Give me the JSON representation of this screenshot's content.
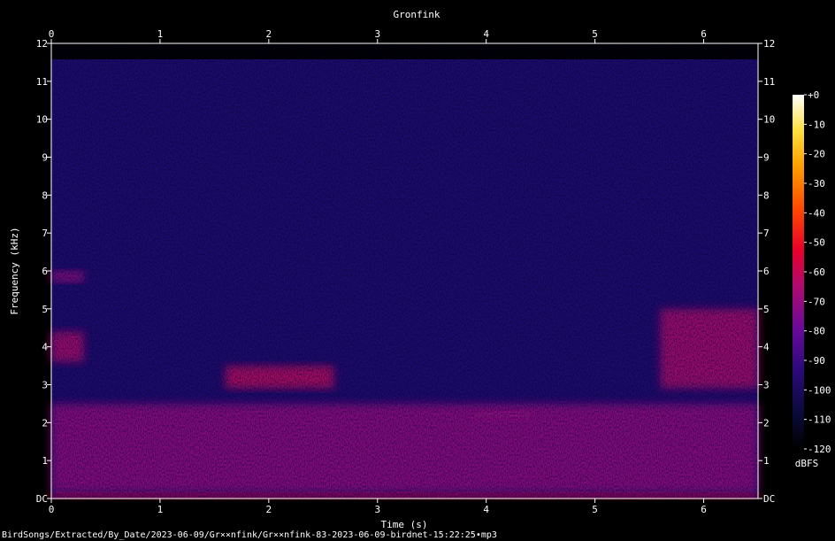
{
  "chart_data": {
    "type": "heatmap",
    "subtype": "spectrogram",
    "title": "Gronfink",
    "xlabel": "Time (s)",
    "ylabel": "Frequency (kHz)",
    "xlim": [
      0,
      6.5
    ],
    "ylim": [
      0,
      12
    ],
    "x_ticks": [
      "0",
      "1",
      "2",
      "3",
      "4",
      "5",
      "6"
    ],
    "y_ticks": [
      "DC",
      "1",
      "2",
      "3",
      "4",
      "5",
      "6",
      "7",
      "8",
      "9",
      "10",
      "11",
      "12"
    ],
    "colorbar": {
      "label": "dBFS",
      "range": [
        -120,
        0
      ],
      "ticks": [
        "+0",
        "-10",
        "-20",
        "-30",
        "-40",
        "-50",
        "-60",
        "-70",
        "-80",
        "-90",
        "-100",
        "-110",
        "-120"
      ]
    },
    "background_level_dbfs": -100,
    "energy_regions": [
      {
        "t_start": 0.0,
        "t_end": 6.5,
        "f_low": 0.0,
        "f_high": 0.15,
        "level_dbfs": -60
      },
      {
        "t_start": 0.0,
        "t_end": 6.5,
        "f_low": 0.15,
        "f_high": 2.5,
        "level_dbfs": -80
      },
      {
        "t_start": 0.0,
        "t_end": 0.3,
        "f_low": 3.6,
        "f_high": 4.4,
        "level_dbfs": -75
      },
      {
        "t_start": 0.0,
        "t_end": 0.3,
        "f_low": 5.7,
        "f_high": 6.0,
        "level_dbfs": -80
      },
      {
        "t_start": 1.6,
        "t_end": 2.6,
        "f_low": 2.9,
        "f_high": 3.5,
        "level_dbfs": -72
      },
      {
        "t_start": 5.6,
        "t_end": 6.5,
        "f_low": 2.9,
        "f_high": 5.0,
        "level_dbfs": -75
      },
      {
        "t_start": 3.9,
        "t_end": 4.4,
        "f_low": 2.1,
        "f_high": 2.3,
        "level_dbfs": -80
      }
    ]
  },
  "footer": {
    "path": "BirdSongs/Extracted/By_Date/2023-06-09/Gr××nfink/Gr××nfink-83-2023-06-09-birdnet-15:22:25•mp3"
  },
  "colors": {
    "background": "#000000",
    "text": "#ffffff",
    "axis": "#ffffff"
  }
}
